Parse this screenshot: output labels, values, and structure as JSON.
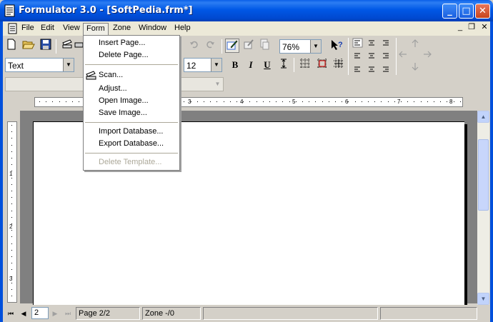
{
  "window": {
    "title": "Formulator 3.0 - [SoftPedia.frm*]",
    "minimize_glyph": "_",
    "maximize_glyph": "□",
    "close_glyph": "✕"
  },
  "menubar": {
    "items": [
      "File",
      "Edit",
      "View",
      "Form",
      "Zone",
      "Window",
      "Help"
    ],
    "mdi_minimize": "_",
    "mdi_restore": "❐",
    "mdi_close": "✕"
  },
  "toolbar": {
    "zoom": "76%",
    "style": "Text",
    "font_size": "12",
    "bold": "B",
    "italic": "I",
    "underline": "U"
  },
  "form_menu": {
    "items": [
      {
        "label": "Insert Page...",
        "enabled": true
      },
      {
        "label": "Delete Page...",
        "enabled": true
      },
      {
        "label": "Scan...",
        "enabled": true
      },
      {
        "label": "Adjust...",
        "enabled": true
      },
      {
        "label": "Open Image...",
        "enabled": true
      },
      {
        "label": "Save Image...",
        "enabled": true
      },
      {
        "label": "Import Database...",
        "enabled": true
      },
      {
        "label": "Export Database...",
        "enabled": true
      },
      {
        "label": "Delete Template...",
        "enabled": false
      }
    ]
  },
  "rulers": {
    "horizontal_numbers": [
      "3",
      "4",
      "5",
      "6",
      "7",
      "8"
    ],
    "vertical_numbers": [
      "1",
      "2",
      "3"
    ]
  },
  "statusbar": {
    "page_input": "2",
    "page": "Page 2/2",
    "zone": "Zone -/0"
  },
  "colors": {
    "titlebar": "#0058e6",
    "frame": "#0050dc",
    "workspace": "#808080"
  }
}
